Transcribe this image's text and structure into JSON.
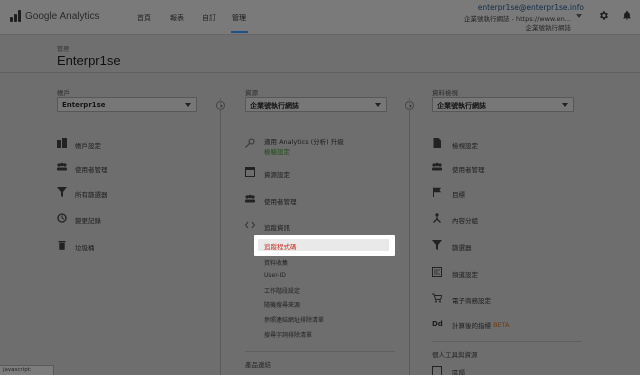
{
  "header": {
    "app_name": "Google Analytics",
    "nav": [
      "首頁",
      "報表",
      "自訂",
      "管理"
    ],
    "active_nav": "管理",
    "account_email": "enterpr1se@enterpr1se.info",
    "account_property": "企業號執行網誌 - https://www.en...",
    "account_view": "企業號執行網誌"
  },
  "page": {
    "breadcrumb": "管理",
    "title": "Enterpr1se"
  },
  "account_col": {
    "heading": "帳戶",
    "selected": "Enterpr1se",
    "items": [
      "帳戶設定",
      "使用者管理",
      "所有篩選器",
      "變更記錄",
      "垃圾桶"
    ]
  },
  "property_col": {
    "heading": "資源",
    "selected": "企業號執行網誌",
    "upgrade_line1": "適用 Analytics (分析) 升級",
    "upgrade_line2": "檢驗設定",
    "items": [
      "資源設定",
      "使用者管理",
      "追蹤資訊"
    ],
    "tracking_sub": [
      "追蹤程式碼",
      "資料收集",
      "User-ID",
      "工作階段設定",
      "隨機搜尋來源",
      "參照連結網址排除清單",
      "搜尋字詞排除清單"
    ],
    "section_footer": "產品連結"
  },
  "view_col": {
    "heading": "資料檢視",
    "selected": "企業號執行網誌",
    "items": [
      "檢視設定",
      "使用者管理",
      "目標",
      "內容分組",
      "篩選器",
      "頻道設定",
      "電子商務設定"
    ],
    "calc_metrics_prefix": "Dd",
    "calc_metrics": "計算後的指標",
    "beta": "BETA",
    "section_footer": "個人工具與資源",
    "last_item": "區隔"
  },
  "status_bar": "javascript:",
  "colors": {
    "highlight_text": "#c62b1f",
    "accent_green": "#1b4d13",
    "nav_underline": "#1f4f86",
    "beta": "#6b3b11"
  }
}
